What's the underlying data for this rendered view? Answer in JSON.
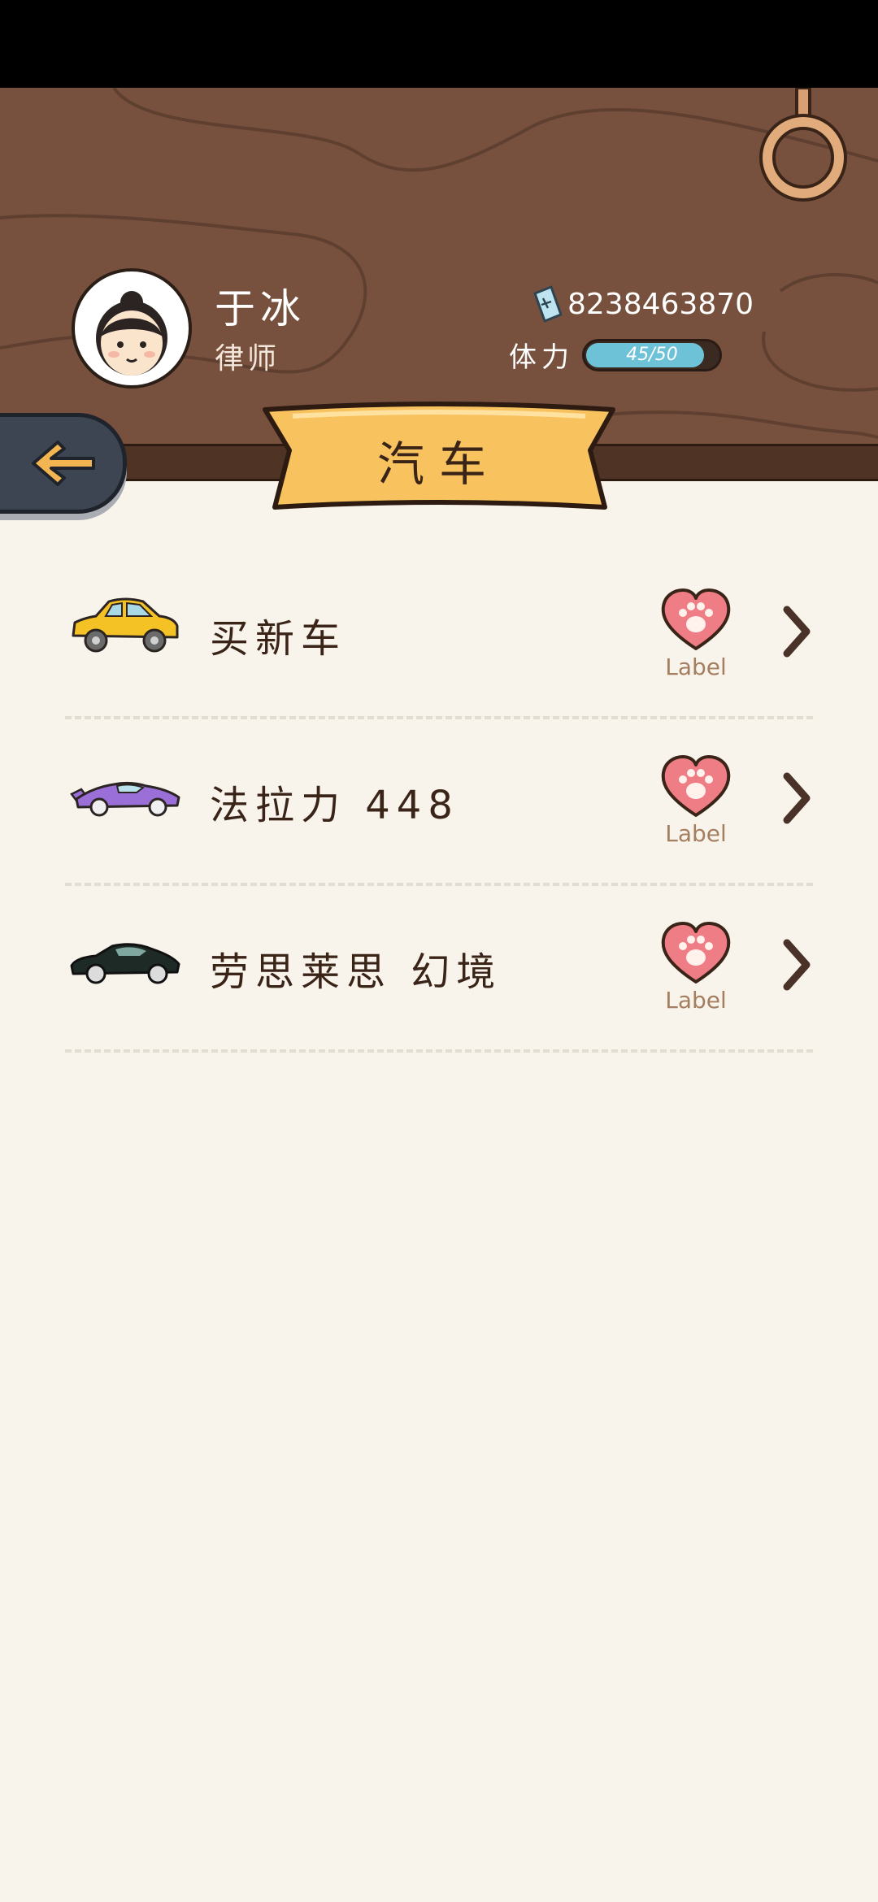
{
  "profile": {
    "name": "于冰",
    "title": "律师",
    "money": "8238463870",
    "stamina_label": "体力",
    "stamina_text": "45/50",
    "stamina_fraction": 0.9
  },
  "page": {
    "title": "汽车"
  },
  "items": [
    {
      "name": "买新车",
      "fav_label": "Label",
      "car_color": "#f5c225"
    },
    {
      "name": "法拉力 448",
      "fav_label": "Label",
      "car_color": "#9b6fd8"
    },
    {
      "name": "劳思莱思 幻境",
      "fav_label": "Label",
      "car_color": "#1e2a26"
    }
  ],
  "icons": {
    "back": "arrow-left-icon",
    "money": "money-icon",
    "favorite": "paw-heart-icon",
    "chevron": "chevron-right-icon"
  },
  "colors": {
    "header_wood": "#77513e",
    "banner": "#f8c35f",
    "heart": "#ef7d86",
    "stamina_fill": "#6ec2d8",
    "back_button": "#3d4452",
    "background": "#f8f4ec"
  }
}
